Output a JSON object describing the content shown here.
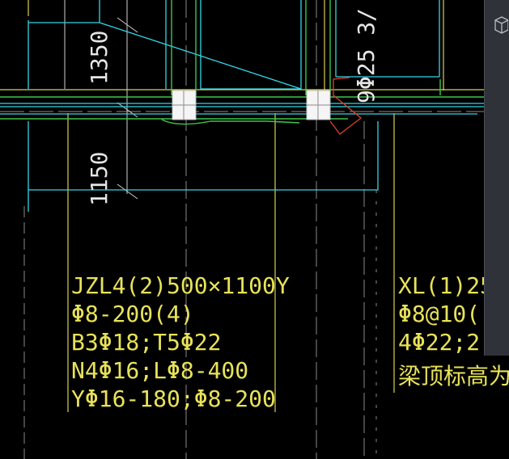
{
  "drawing": {
    "beam_label_left": {
      "line1": "JZL4(2)500×1100Y",
      "line2": "Φ8-200(4)",
      "line3": "B3Φ18;T5Φ22",
      "line4": "N4Φ16;LΦ8-400",
      "line5": "YΦ16-180;Φ8-200"
    },
    "beam_label_right": {
      "line1": "XL(1)25",
      "line2": "Φ8@10(",
      "line3": "4Φ22;2",
      "line4": "梁顶标高为"
    },
    "dim_1350": "1350",
    "dim_1150": "1150",
    "rebar_note": "9Φ25 3/"
  },
  "colors": {
    "background": "#000000",
    "cyan": "#33d6e8",
    "yellow": "#e8e25a",
    "green": "#3ec64a",
    "white": "#e6e6e6",
    "red": "#e0402a",
    "gray": "#9a9a9a",
    "panel": "#2f3238"
  },
  "ui": {
    "viewcube_icon": "viewcube-icon"
  }
}
